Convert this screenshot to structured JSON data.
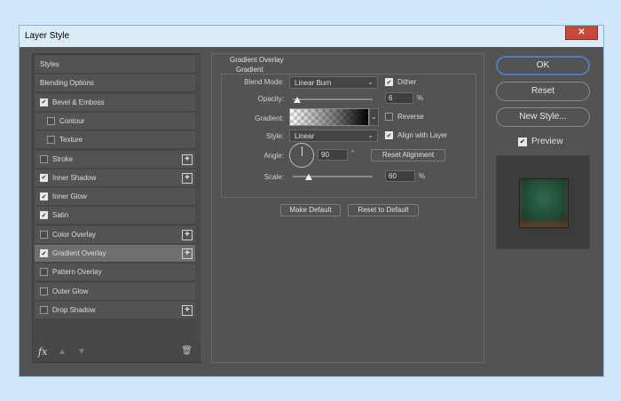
{
  "window": {
    "title": "Layer Style",
    "close_label": "✕"
  },
  "styles_list": [
    {
      "label": "Styles",
      "checkbox": false,
      "checked": false,
      "plus": false,
      "indent": false
    },
    {
      "label": "Blending Options",
      "checkbox": false,
      "checked": false,
      "plus": false,
      "indent": false
    },
    {
      "label": "Bevel & Emboss",
      "checkbox": true,
      "checked": true,
      "plus": false,
      "indent": false
    },
    {
      "label": "Contour",
      "checkbox": true,
      "checked": false,
      "plus": false,
      "indent": true
    },
    {
      "label": "Texture",
      "checkbox": true,
      "checked": false,
      "plus": false,
      "indent": true
    },
    {
      "label": "Stroke",
      "checkbox": true,
      "checked": false,
      "plus": true,
      "indent": false
    },
    {
      "label": "Inner Shadow",
      "checkbox": true,
      "checked": true,
      "plus": true,
      "indent": false
    },
    {
      "label": "Inner Glow",
      "checkbox": true,
      "checked": true,
      "plus": false,
      "indent": false
    },
    {
      "label": "Satin",
      "checkbox": true,
      "checked": true,
      "plus": false,
      "indent": false
    },
    {
      "label": "Color Overlay",
      "checkbox": true,
      "checked": false,
      "plus": true,
      "indent": false
    },
    {
      "label": "Gradient Overlay",
      "checkbox": true,
      "checked": true,
      "plus": true,
      "indent": false,
      "selected": true
    },
    {
      "label": "Pattern Overlay",
      "checkbox": true,
      "checked": false,
      "plus": false,
      "indent": false
    },
    {
      "label": "Outer Glow",
      "checkbox": true,
      "checked": false,
      "plus": false,
      "indent": false
    },
    {
      "label": "Drop Shadow",
      "checkbox": true,
      "checked": false,
      "plus": true,
      "indent": false
    }
  ],
  "footer_icons": {
    "fx": "fx",
    "up": "▲",
    "down": "▼",
    "trash": "🗑"
  },
  "panel": {
    "group_title": "Gradient Overlay",
    "sub_title": "Gradient",
    "blend_mode_label": "Blend Mode:",
    "blend_mode_value": "Linear Burn",
    "dither_label": "Dither",
    "opacity_label": "Opacity:",
    "opacity_value": "6",
    "opacity_fraction": 0.06,
    "gradient_label": "Gradient:",
    "reverse_label": "Reverse",
    "style_label": "Style:",
    "style_value": "Linear",
    "align_label": "Align with Layer",
    "angle_label": "Angle:",
    "angle_value": "90",
    "degree_symbol": "°",
    "reset_alignment_label": "Reset Alignment",
    "scale_label": "Scale:",
    "scale_value": "60",
    "scale_fraction": 0.2,
    "percent": "%",
    "make_default_label": "Make Default",
    "reset_default_label": "Reset to Default"
  },
  "actions": {
    "ok": "OK",
    "reset": "Reset",
    "new_style": "New Style...",
    "preview": "Preview"
  },
  "colors": {
    "accent": "#4b7fc0",
    "panel_bg": "#535353",
    "window_frame": "#dcebfa"
  }
}
